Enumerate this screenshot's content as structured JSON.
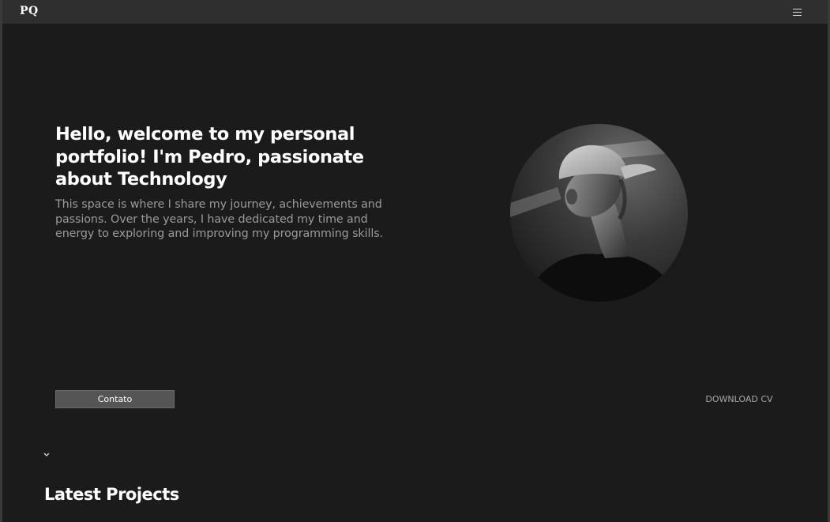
{
  "navbar": {
    "logo": "PQ",
    "menu_icon": "hamburger-menu-icon"
  },
  "hero": {
    "title": "Hello, welcome to my personal portfolio! I'm Pedro, passionate about Technology",
    "description": "This space is where I share my journey, achievements and passions. Over the years, I have dedicated my time and energy to exploring and improving my programming skills.",
    "avatar_alt": "profile-photo",
    "contact_label": "Contato",
    "download_label": "DOWNLOAD CV",
    "scroll_icon": "chevron-down-icon"
  },
  "projects": {
    "title": "Latest Projects"
  },
  "colors": {
    "background": "#1b1b1b",
    "navbar": "#2f2f2f",
    "text_primary": "#ffffff",
    "text_secondary": "#9a9a9a",
    "button_bg": "#555555"
  }
}
